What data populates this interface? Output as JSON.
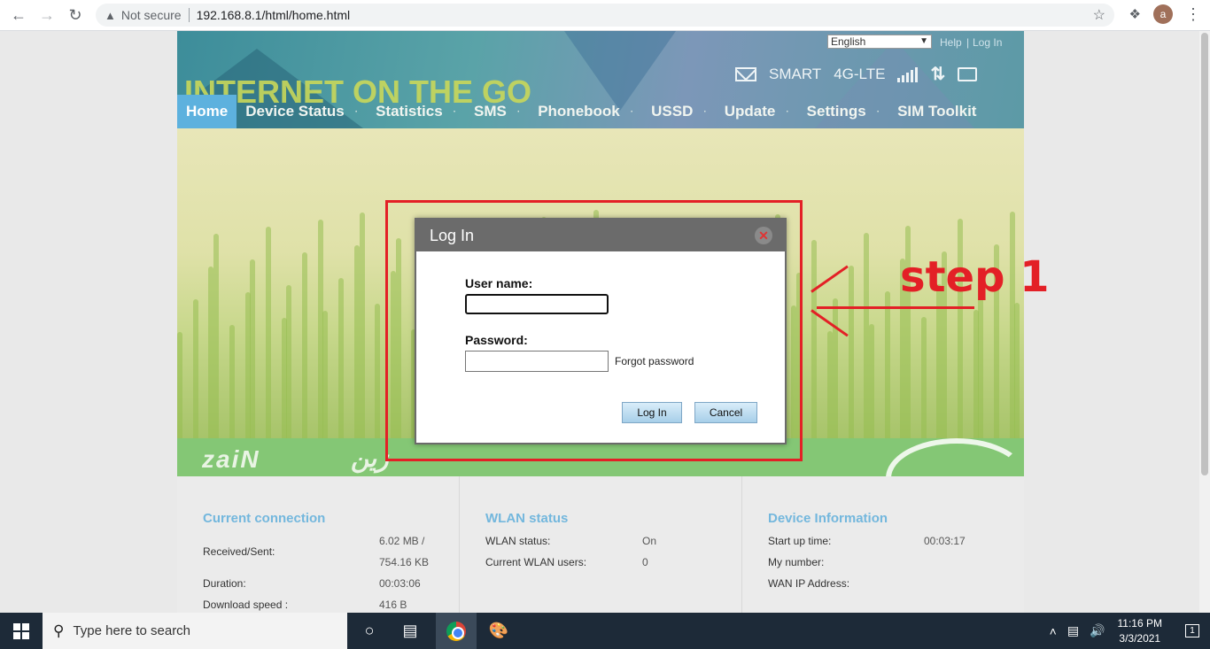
{
  "browser": {
    "security_label": "Not secure",
    "url": "192.168.8.1/html/home.html",
    "avatar_letter": "a"
  },
  "header": {
    "slogan": "INTERNET ON THE GO",
    "language": "English",
    "help_label": "Help",
    "login_label": "Log In",
    "status_operator": "SMART",
    "status_network": "4G-LTE"
  },
  "menu": {
    "items": [
      {
        "label": "Home",
        "active": true
      },
      {
        "label": "Device Status"
      },
      {
        "label": "Statistics"
      },
      {
        "label": "SMS"
      },
      {
        "label": "Phonebook"
      },
      {
        "label": "USSD"
      },
      {
        "label": "Update"
      },
      {
        "label": "Settings"
      },
      {
        "label": "SIM Toolkit"
      }
    ]
  },
  "brand": {
    "logo_text": "zaiN",
    "logo_ar": "زين"
  },
  "login_dialog": {
    "title": "Log In",
    "username_label": "User name:",
    "username_value": "",
    "password_label": "Password:",
    "password_value": "",
    "forgot_label": "Forgot password",
    "login_button": "Log In",
    "cancel_button": "Cancel"
  },
  "annotation": {
    "text": "step 1",
    "color": "#e32026"
  },
  "panels": {
    "connection": {
      "title": "Current connection",
      "received_sent_label": "Received/Sent:",
      "received_value": "6.02 MB /",
      "sent_value": "754.16 KB",
      "duration_label": "Duration:",
      "duration_value": "00:03:06",
      "download_label": "Download speed :",
      "download_value": "416 B"
    },
    "wlan": {
      "title": "WLAN status",
      "status_label": "WLAN status:",
      "status_value": "On",
      "users_label": "Current WLAN users:",
      "users_value": "0"
    },
    "device": {
      "title": "Device Information",
      "startup_label": "Start up time:",
      "startup_value": "00:03:17",
      "number_label": "My number:",
      "wan_label": "WAN IP Address:"
    }
  },
  "taskbar": {
    "search_placeholder": "Type here to search",
    "time": "11:16 PM",
    "date": "3/3/2021",
    "notification_count": "1"
  },
  "colors": {
    "accent": "#73b7dd",
    "menu_active": "#5db1de",
    "annotation": "#e32026",
    "dialog_header": "#6b6b6b"
  }
}
